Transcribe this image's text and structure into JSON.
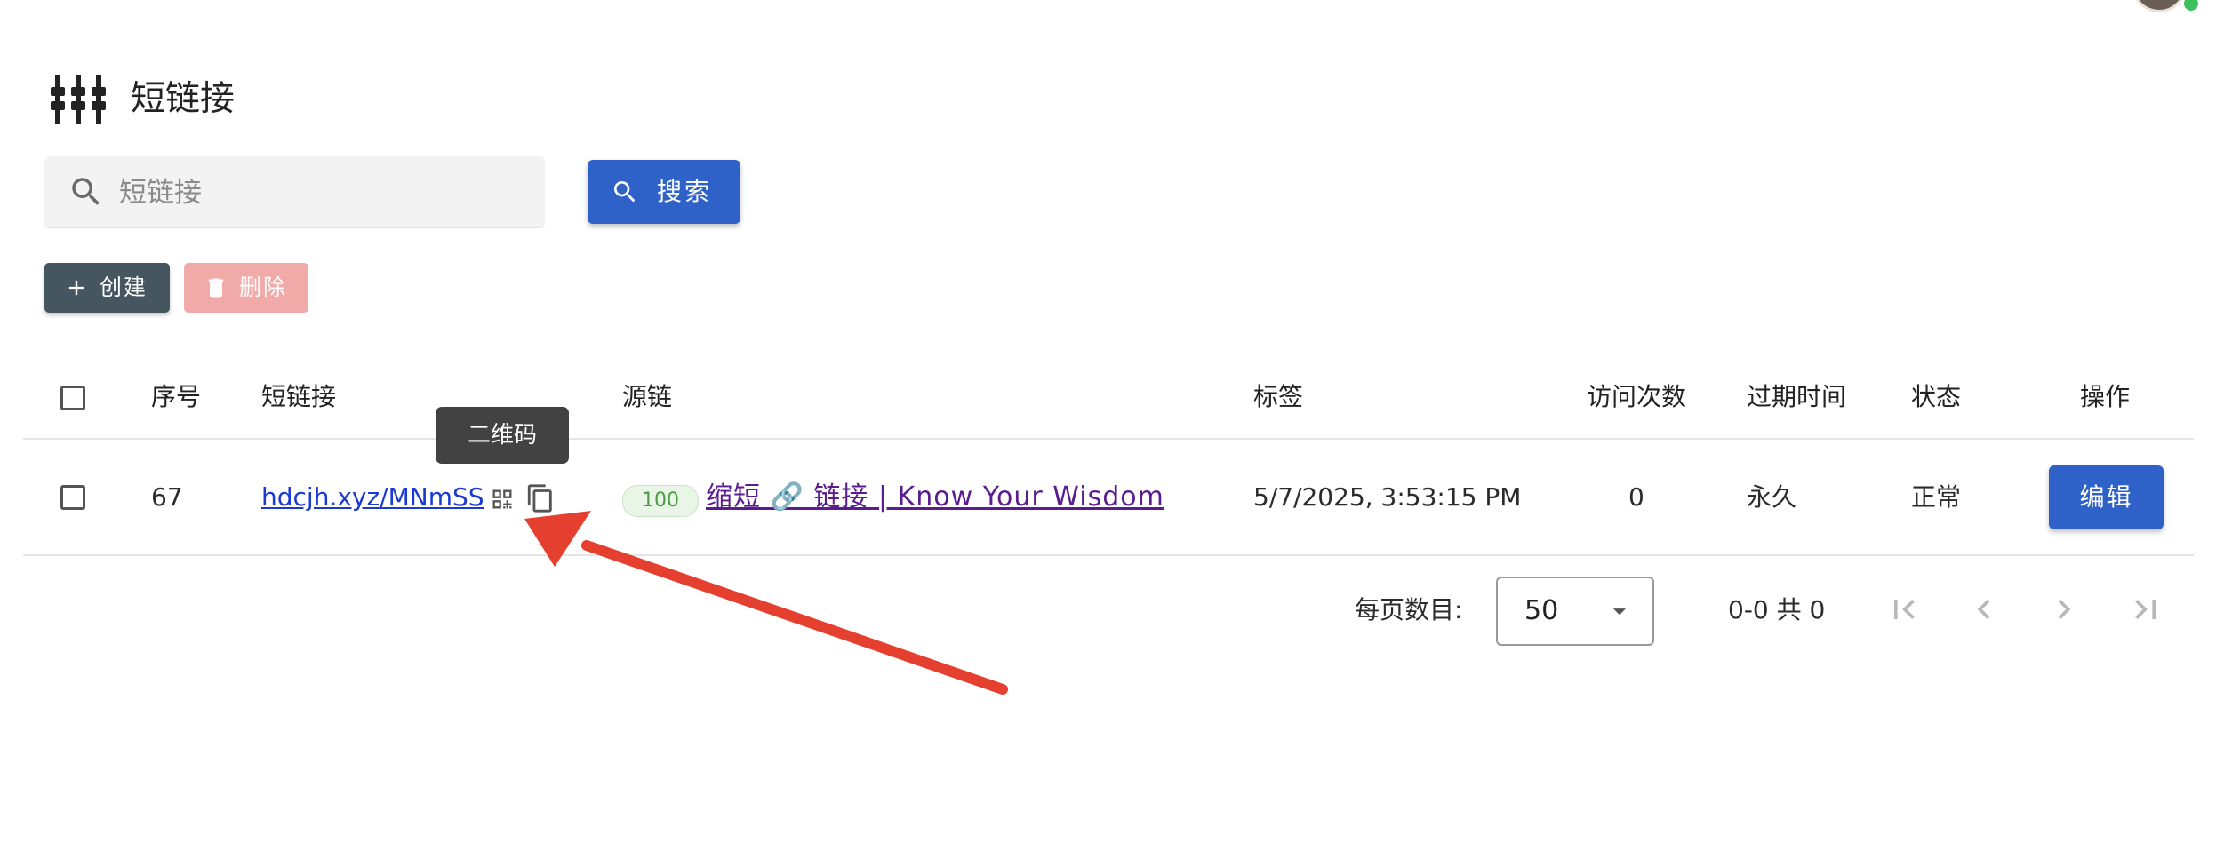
{
  "header": {
    "title": "短链接",
    "icon": "tune-sliders-icon"
  },
  "search": {
    "placeholder": "短链接",
    "value": "",
    "button_label": "搜索"
  },
  "toolbar": {
    "create_label": "创建",
    "delete_label": "删除"
  },
  "table": {
    "columns": [
      "序号",
      "短链接",
      "源链",
      "标签",
      "访问次数",
      "过期时间",
      "状态",
      "操作"
    ],
    "rows": [
      {
        "index": "67",
        "short_link": "hdcjh.xyz/MNmSS",
        "source_score": "100",
        "source_title": "缩短 🔗 链接 | Know Your Wisdom",
        "tag": "5/7/2025, 3:53:15 PM",
        "visits": "0",
        "expire": "永久",
        "status": "正常",
        "action_label": "编辑"
      }
    ]
  },
  "tooltip": {
    "text": "二维码"
  },
  "pagination": {
    "per_page_label": "每页数目:",
    "per_page_value": "50",
    "range_text": "0-0 共 0"
  },
  "colors": {
    "primary": "#2f62c8",
    "create": "#465660",
    "delete_disabled": "#f0aaa8",
    "annotation_arrow": "#e5402f"
  }
}
